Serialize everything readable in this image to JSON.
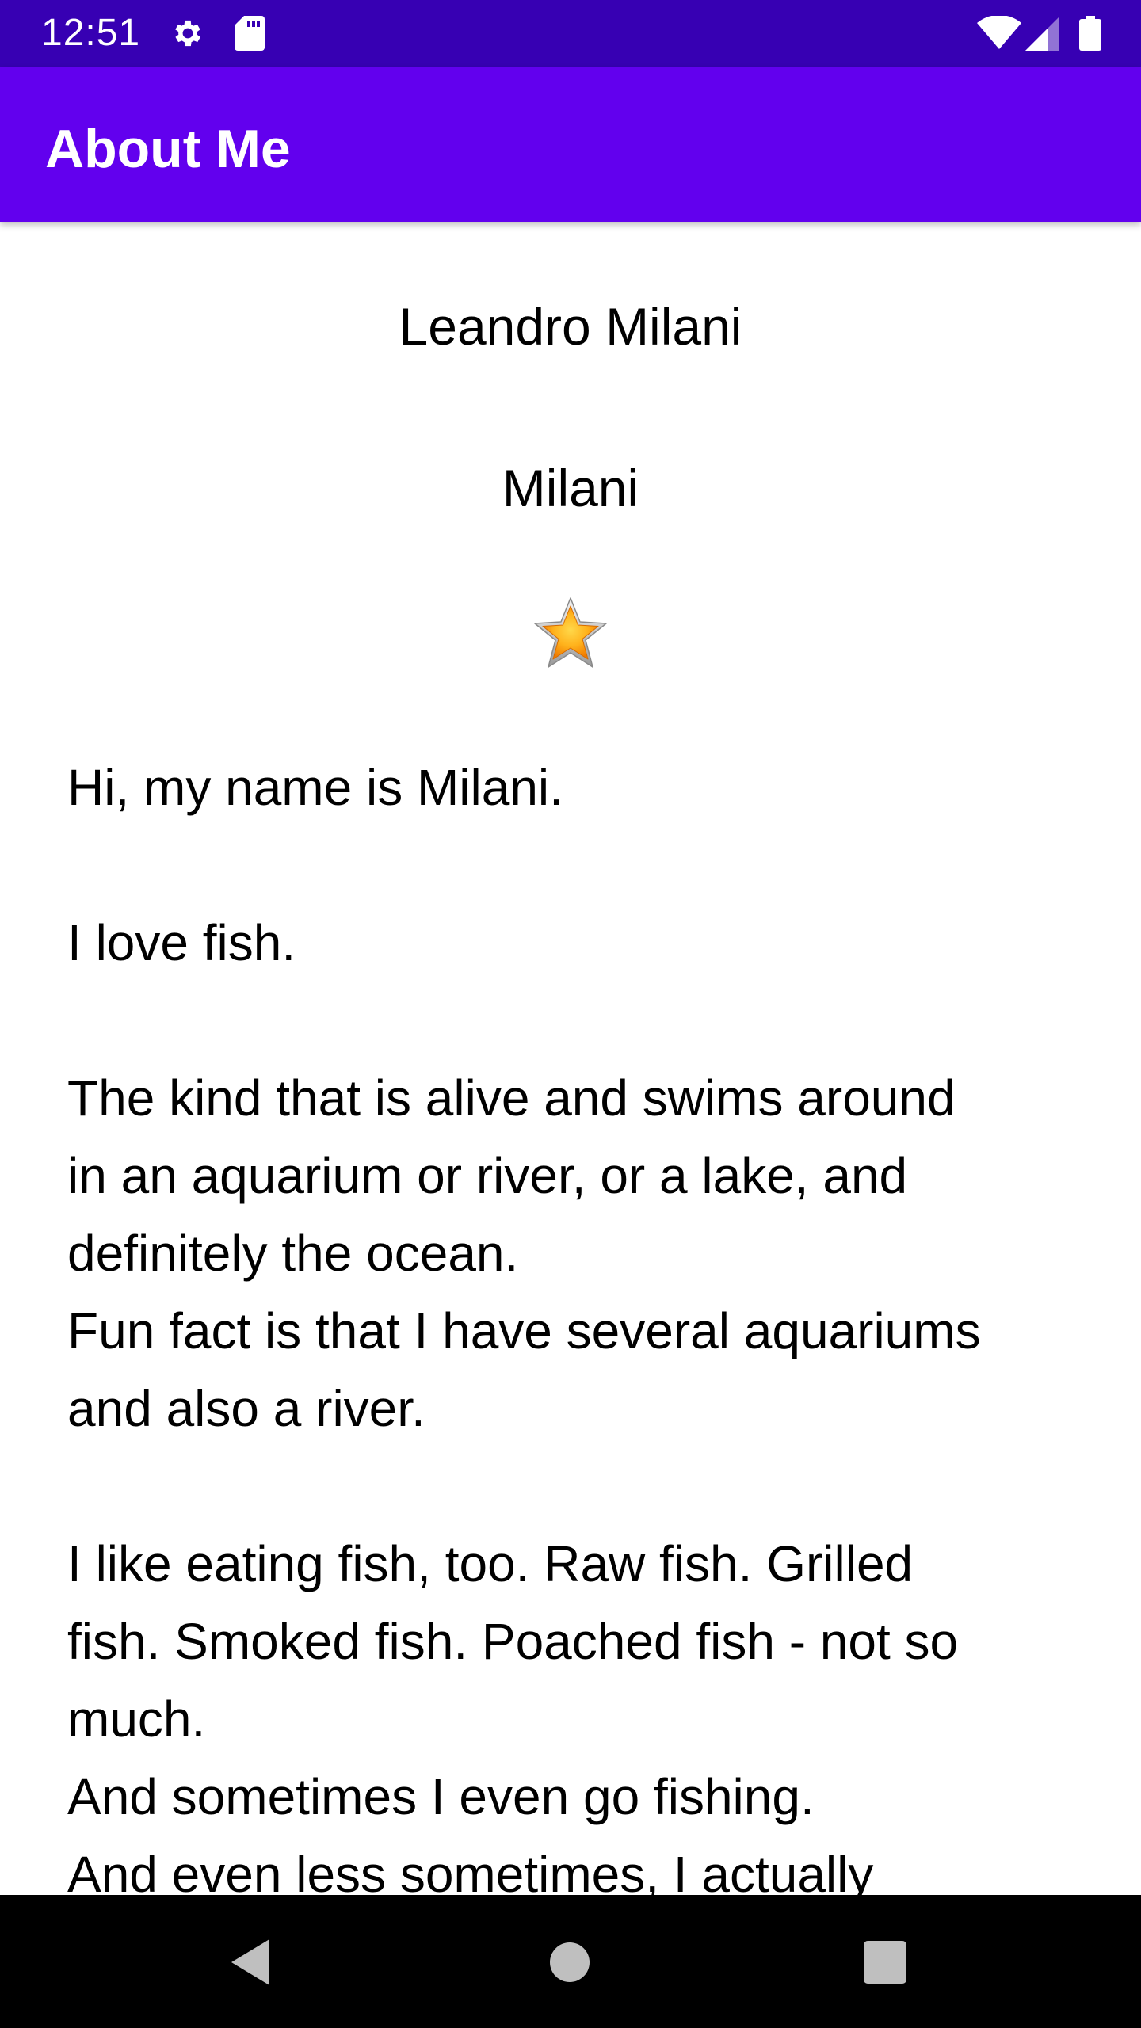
{
  "status_bar": {
    "time": "12:51",
    "icons": [
      "gear-icon",
      "sd-card-icon",
      "wifi-icon",
      "cell-signal-icon",
      "battery-icon"
    ],
    "background_color": "#3700b3"
  },
  "app_bar": {
    "title": "About Me",
    "background_color": "#6200ee"
  },
  "profile": {
    "name": "Leandro Milani",
    "nickname": "Milani",
    "image_icon": "star-icon"
  },
  "bio": {
    "lines": [
      "Hi, my name is Milani.",
      "",
      "I love fish.",
      "",
      "The kind that is alive and swims around",
      "in an aquarium or river, or a lake, and",
      "definitely the ocean.",
      "Fun fact is that I have several aquariums",
      "and also a river.",
      "",
      "I like eating fish, too. Raw fish. Grilled",
      "fish. Smoked fish. Poached fish - not so",
      "much.",
      "And sometimes I even go fishing.",
      "And even less sometimes, I actually"
    ]
  },
  "nav_bar": {
    "back_icon": "back-triangle-icon",
    "home_icon": "home-circle-icon",
    "recents_icon": "recents-square-icon"
  }
}
